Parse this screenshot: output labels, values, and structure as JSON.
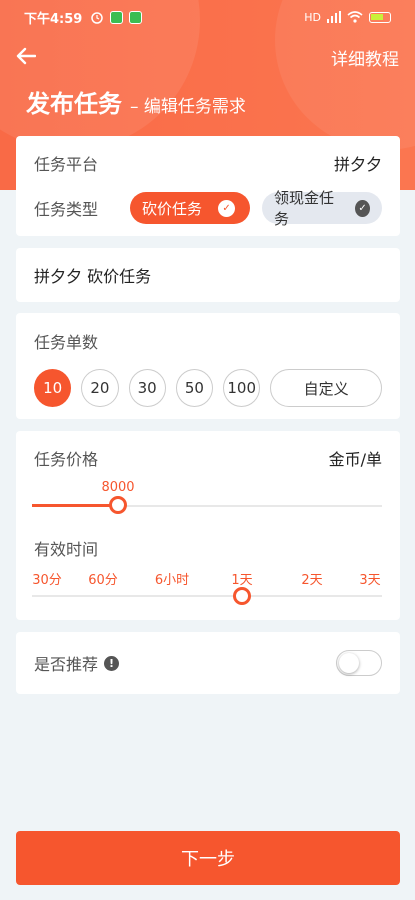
{
  "statusbar": {
    "time": "下午4:59",
    "network": "HD"
  },
  "nav": {
    "tutorial": "详细教程"
  },
  "header": {
    "title": "发布任务",
    "subtitle": "– 编辑任务需求"
  },
  "platform": {
    "label": "任务平台",
    "value": "拼夕夕"
  },
  "task_type": {
    "label": "任务类型",
    "options": [
      {
        "label": "砍价任务",
        "selected": true
      },
      {
        "label": "领现金任务",
        "selected": false
      }
    ]
  },
  "task_name": {
    "value": "拼夕夕 砍价任务"
  },
  "count": {
    "label": "任务单数",
    "options": [
      "10",
      "20",
      "30",
      "50",
      "100"
    ],
    "selected": "10",
    "custom_label": "自定义"
  },
  "price": {
    "label": "任务价格",
    "unit": "金币/单",
    "value": "8000",
    "fraction": 0.25
  },
  "duration": {
    "label": "有效时间",
    "ticks": [
      "30分",
      "60分",
      "6小时",
      "1天",
      "2天",
      "3天"
    ],
    "selected": "1天"
  },
  "recommend": {
    "label": "是否推荐",
    "enabled": false
  },
  "next_button": "下一步",
  "colors": {
    "accent": "#f6562e",
    "header": "#f96a46",
    "background": "#eff4f7"
  }
}
